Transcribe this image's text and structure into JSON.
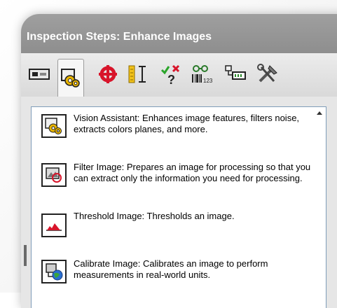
{
  "panel": {
    "title": "Inspection Steps: Enhance Images"
  },
  "toolbar": {
    "tools": [
      {
        "icon": "acquire-image-icon"
      },
      {
        "icon": "enhance-images-icon",
        "active": true
      },
      {
        "icon": "locate-features-icon"
      },
      {
        "icon": "measure-features-icon"
      },
      {
        "icon": "check-presence-icon"
      },
      {
        "icon": "identify-parts-icon"
      },
      {
        "icon": "use-additional-tools-icon"
      },
      {
        "icon": "tools-icon"
      }
    ]
  },
  "steps": [
    {
      "icon": "vision-assistant-icon",
      "text": "Vision Assistant:  Enhances image features, filters noise, extracts colors planes, and more."
    },
    {
      "icon": "filter-image-icon",
      "text": "Filter Image:  Prepares an image for processing so that you can extract only the information you need for processing."
    },
    {
      "icon": "threshold-image-icon",
      "text": "Threshold Image:  Thresholds an image."
    },
    {
      "icon": "calibrate-image-icon",
      "text": "Calibrate Image:  Calibrates an image to perform measurements in real-world units."
    }
  ]
}
